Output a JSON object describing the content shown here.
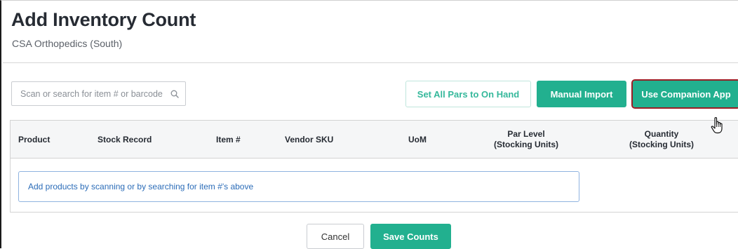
{
  "header": {
    "title": "Add Inventory Count",
    "subtitle": "CSA Orthopedics (South)"
  },
  "toolbar": {
    "search_placeholder": "Scan or search for item # or barcode",
    "set_pars_label": "Set All Pars to On Hand",
    "manual_import_label": "Manual Import",
    "companion_app_label": "Use Companion App"
  },
  "table": {
    "columns": {
      "product": "Product",
      "stock_record": "Stock Record",
      "item_no": "Item #",
      "vendor_sku": "Vendor SKU",
      "uom": "UoM",
      "par_level": "Par Level",
      "par_level_sub": "(Stocking Units)",
      "quantity": "Quantity",
      "quantity_sub": "(Stocking Units)"
    },
    "empty_message": "Add products by scanning or by searching for item #'s above"
  },
  "footer": {
    "cancel_label": "Cancel",
    "save_label": "Save Counts"
  },
  "colors": {
    "accent": "#22b08f",
    "highlight": "#9c1c24",
    "info": "#2b6cb8"
  },
  "icons": {
    "search": "search-icon",
    "cursor": "hand-pointer-icon"
  }
}
